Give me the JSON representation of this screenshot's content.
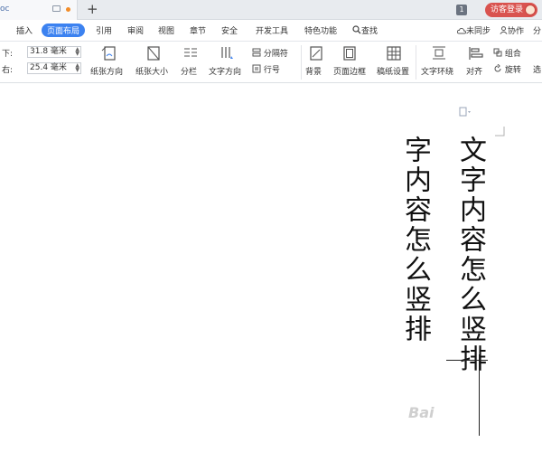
{
  "tabbar": {
    "doc_tab_name": "oc",
    "new_tab_symbol": "+",
    "badge": "1",
    "visitor_login": "访客登录"
  },
  "menu": {
    "items": [
      "插入",
      "页面布局",
      "引用",
      "审阅",
      "视图",
      "章节",
      "安全",
      "开发工具",
      "特色功能"
    ],
    "search": "查找",
    "right": [
      "未同步",
      "协作",
      "分"
    ]
  },
  "margins": {
    "bottom_label": "下:",
    "bottom_value": "31.8 毫米",
    "right_label": "右:",
    "right_value": "25.4 毫米"
  },
  "toolbar": {
    "orientation": "纸张方向",
    "size": "纸张大小",
    "columns": "分栏",
    "text_direction": "文字方向",
    "separator": "分隔符",
    "line_number": "行号",
    "background": "背景",
    "page_border": "页面边框",
    "draft_paper": "稿纸设置",
    "text_wrap": "文字环绕",
    "align": "对齐",
    "group": "组合",
    "rotate": "旋转",
    "select": "选"
  },
  "document": {
    "column_1": "文字内容怎么竖排",
    "column_2": "字内容怎么竖排"
  },
  "watermark": "Bai"
}
